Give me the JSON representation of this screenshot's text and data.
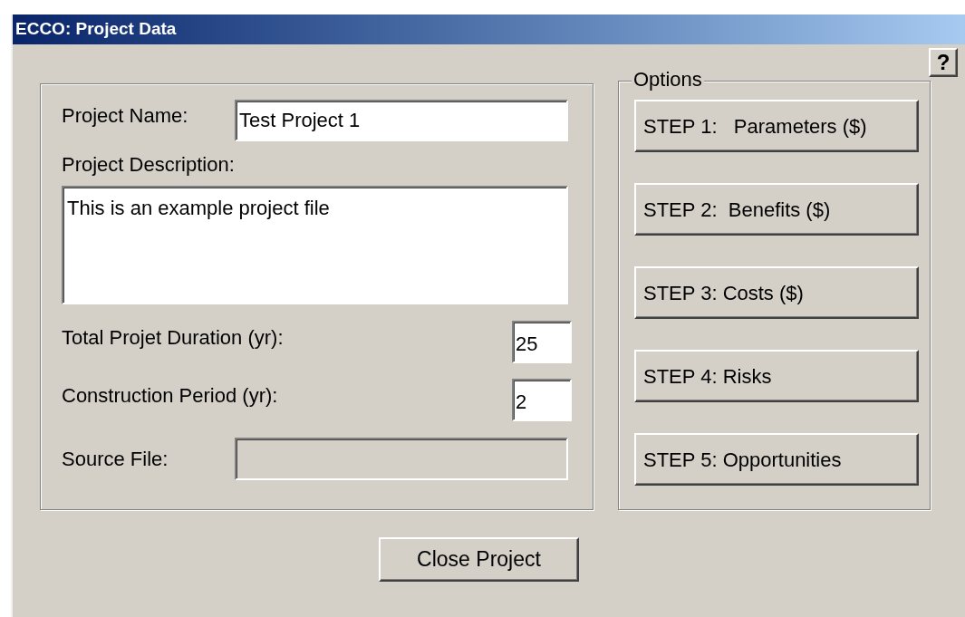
{
  "window": {
    "title": "ECCO: Project Data"
  },
  "project": {
    "name_label": "Project Name:",
    "name_value": "Test Project 1",
    "description_label": "Project Description:",
    "description_value": "This is an example project file",
    "numeric_fields": [
      {
        "label": "Total Projet Duration (yr):",
        "value": "25"
      },
      {
        "label": "Construction Period (yr):",
        "value": "2"
      }
    ],
    "source_file": {
      "label": "Source File:",
      "disabled": true
    }
  },
  "options": {
    "title": "Options",
    "buttons": [
      "STEP 1:   Parameters ($)",
      "STEP 2:  Benefits ($)",
      "STEP 3: Costs ($)",
      "STEP 4: Risks",
      "STEP 5: Opportunities"
    ]
  },
  "help_button": {
    "label": "?"
  },
  "close_button": "Close Project"
}
